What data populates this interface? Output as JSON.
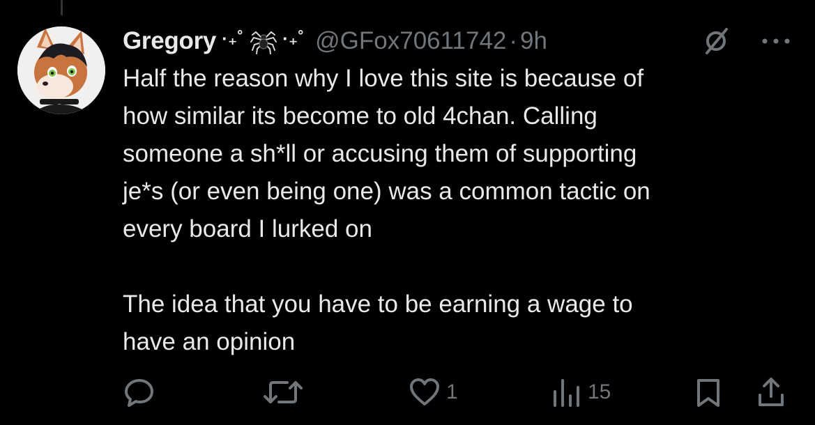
{
  "tweet": {
    "display_name": "Gregory",
    "deco_left": "·₊˚",
    "deco_right": "·₊˚",
    "handle": "@GFox70611742",
    "separator": "·",
    "time": "9h",
    "text": "Half the reason why I love this site is because of\nhow similar its become to old 4chan. Calling\nsomeone a sh*ll or accusing them of supporting\nje*s (or even being one) was a common tactic on\nevery board I lurked on\n\nThe idea that you have to be earning a wage to\nhave an opinion"
  },
  "actions": {
    "replies": "",
    "reposts": "",
    "likes": "1",
    "views": "15"
  },
  "colors": {
    "background": "#000000",
    "text": "#e7e9ea",
    "muted": "#71767b"
  },
  "icons": [
    "reply-icon",
    "repost-icon",
    "like-icon",
    "views-icon",
    "bookmark-icon",
    "share-icon",
    "grok-icon",
    "more-icon",
    "spider-emoji"
  ]
}
